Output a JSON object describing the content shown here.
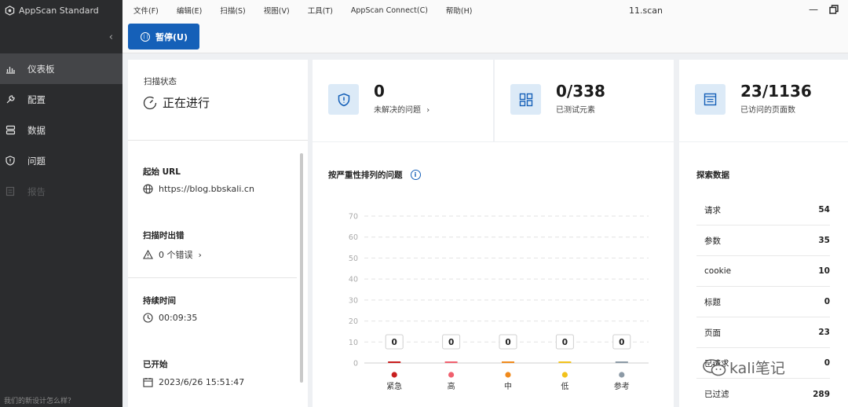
{
  "app": {
    "name": "AppScan Standard",
    "feedback": "我们的新设计怎么样？"
  },
  "sidebar": {
    "items": [
      {
        "label": "仪表板",
        "icon": "bar-chart-icon",
        "active": true
      },
      {
        "label": "配置",
        "icon": "wrench-icon"
      },
      {
        "label": "数据",
        "icon": "database-icon"
      },
      {
        "label": "问题",
        "icon": "shield-icon"
      },
      {
        "label": "报告",
        "icon": "report-icon",
        "disabled": true
      }
    ]
  },
  "menu": [
    "文件(F)",
    "编辑(E)",
    "扫描(S)",
    "视图(V)",
    "工具(T)",
    "AppScan Connect(C)",
    "帮助(H)"
  ],
  "window": {
    "title": "11.scan",
    "minimize": "—"
  },
  "toolbar": {
    "pause_label": "暂停(U)"
  },
  "status": {
    "scan_status_label": "扫描状态",
    "scan_status_value": "正在进行",
    "start_url_label": "起始 URL",
    "start_url_value": "https://blog.bbskali.cn",
    "scan_errors_label": "扫描时出错",
    "scan_errors_value": "0 个错误",
    "duration_label": "持续时间",
    "duration_value": "00:09:35",
    "started_label": "已开始",
    "started_value": "2023/6/26 15:51:47"
  },
  "kpis": [
    {
      "value": "0",
      "sub": "未解决的问题",
      "icon": "shield-icon",
      "chevron": "›"
    },
    {
      "value": "0/338",
      "sub": "已测试元素",
      "icon": "elements-icon"
    },
    {
      "value": "23/1136",
      "sub": "已访问的页面数",
      "icon": "page-icon"
    }
  ],
  "chart_title": "按严重性排列的问题",
  "chart_data": {
    "type": "bar",
    "title": "按严重性排列的问题",
    "categories": [
      "紧急",
      "高",
      "中",
      "低",
      "参考"
    ],
    "values": [
      0,
      0,
      0,
      0,
      0
    ],
    "ylim": [
      0,
      70
    ],
    "yticks": [
      0,
      10,
      20,
      30,
      40,
      50,
      60,
      70
    ],
    "grid": true,
    "colors": [
      "#c81e1e",
      "#f0606e",
      "#f08a1c",
      "#f2c21b",
      "#8c9aa6"
    ]
  },
  "explore": {
    "title": "探索数据",
    "rows": [
      {
        "label": "请求",
        "value": "54"
      },
      {
        "label": "参数",
        "value": "35"
      },
      {
        "label": "cookie",
        "value": "10"
      },
      {
        "label": "标题",
        "value": "0"
      },
      {
        "label": "页面",
        "value": "23"
      },
      {
        "label": "已请求",
        "value": "0"
      },
      {
        "label": "已过滤",
        "value": "289"
      }
    ]
  },
  "watermark": "kali笔记"
}
